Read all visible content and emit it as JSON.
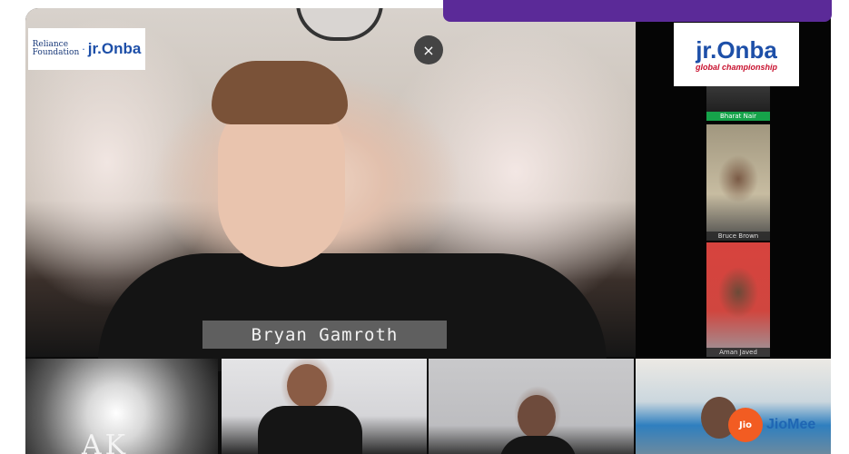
{
  "meeting": {
    "main_speaker_name": "Bryan Gamroth",
    "close_label": "×"
  },
  "branding": {
    "reliance_line1": "Reliance",
    "reliance_line2": "Foundation",
    "separator": "·",
    "jrnba_logo": "jr.Onba",
    "badge_main": "jr.Onba",
    "badge_sub": "global championship"
  },
  "participants": [
    {
      "name": "Bharat Nair",
      "color": "#16a34a"
    },
    {
      "name": "Bruce Brown"
    },
    {
      "name": "Aman Javed"
    }
  ],
  "bottom_tiles": {
    "initials": "AK",
    "jio_icon": "Jio",
    "jio_label": "JioMee"
  },
  "colors": {
    "banner": "#5b2a98",
    "jio_orange": "#f25c22",
    "jio_blue": "#1f66b3",
    "nba_blue": "#1d4fa8",
    "nba_red": "#c8102e"
  }
}
